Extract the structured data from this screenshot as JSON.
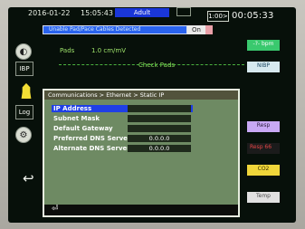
{
  "status_bar": {
    "date": "2016-01-22",
    "time": "15:05:43",
    "patient_type": "Adult",
    "alarm_audio": "",
    "counter": "1:00>",
    "elapsed": "00:05:33"
  },
  "message_bar": {
    "text": "Unable Pad/Pace Cables Detected",
    "status": "On"
  },
  "left_sidebar": {
    "items": [
      {
        "icon": "circle-icon"
      },
      {
        "icon": "nibp-icon",
        "label": "IBP"
      },
      {
        "icon": "bell-icon"
      },
      {
        "icon": "log-icon",
        "label": "Log"
      },
      {
        "icon": "gear-icon"
      },
      {
        "icon": "back-arrow-icon"
      }
    ]
  },
  "waveform": {
    "lead": "Pads",
    "scale": "1.0 cm/mV",
    "check_pads": "Check Pads"
  },
  "right_tiles": {
    "t1": "-?- bpm",
    "t2": "NIBP",
    "t3": "Resp",
    "t4": "Resp 66",
    "t5": "CO2",
    "t6": "Temp"
  },
  "dialog": {
    "breadcrumb": "Communications > Ethernet > Static IP",
    "fields": [
      {
        "label": "IP Address",
        "value": "",
        "selected": true
      },
      {
        "label": "Subnet Mask",
        "value": ""
      },
      {
        "label": "Default Gateway",
        "value": ""
      },
      {
        "label": "Preferred DNS Server",
        "value": "0.0.0.0"
      },
      {
        "label": "Alternate DNS Server",
        "value": "0.0.0.0"
      }
    ],
    "enter_icon": "enter-arrow-icon"
  }
}
